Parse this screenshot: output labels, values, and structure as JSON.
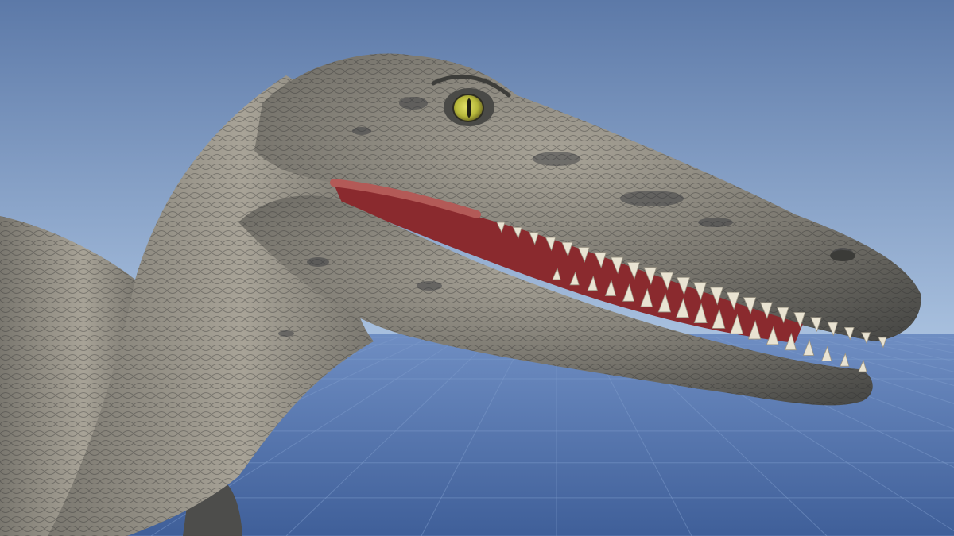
{
  "scene": {
    "subject": "dinosaur-head",
    "colors": {
      "sky_top": "#5c79a8",
      "sky_horizon": "#a9c1df",
      "ground_near": "#3f5f99",
      "ground_far": "#6f8ec3",
      "grid_line": "#7e9bcc",
      "skin_light": "#a8a397",
      "skin_mid": "#7a776f",
      "skin_dark": "#4a4a47",
      "mouth": "#8a2a2e",
      "gum": "#b35a57",
      "teeth": "#e9e3d2",
      "eye": "#b7b83b"
    }
  }
}
